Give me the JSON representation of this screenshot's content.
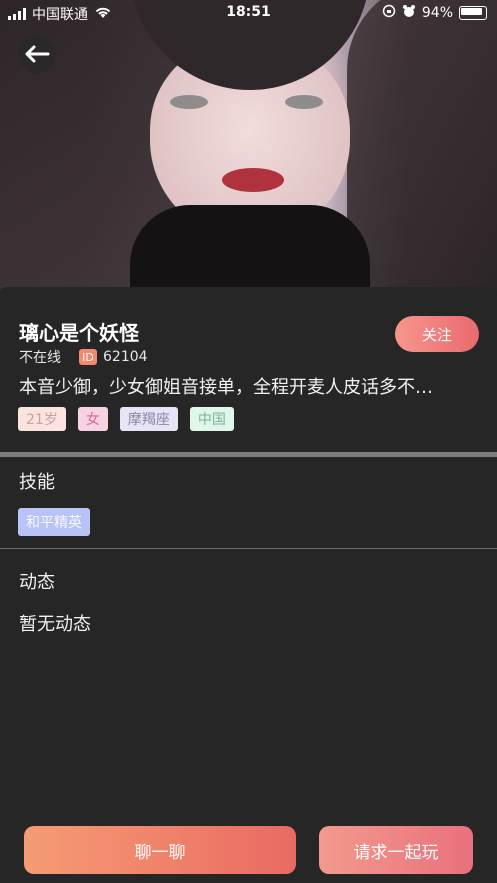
{
  "status_bar": {
    "carrier": "中国联通",
    "time": "18:51",
    "battery": "94%",
    "icons": [
      "signal-icon",
      "wifi-icon",
      "lock-rotation-icon",
      "alarm-icon",
      "battery-icon"
    ]
  },
  "header": {
    "back_icon": "arrow-left-icon"
  },
  "profile": {
    "name": "璃心是个妖怪",
    "follow_label": "关注",
    "status": "不在线",
    "id_badge": "ID",
    "id_number": "62104",
    "bio": "本音少御，少女御姐音接单，全程开麦人皮话多不…",
    "tags": {
      "age": "21岁",
      "gender": "女",
      "zodiac": "摩羯座",
      "country": "中国"
    }
  },
  "skills": {
    "title": "技能",
    "items": [
      "和平精英"
    ]
  },
  "moments": {
    "title": "动态",
    "empty_text": "暂无动态"
  },
  "actions": {
    "chat_label": "聊一聊",
    "play_label": "请求一起玩"
  },
  "colors": {
    "background": "#262626",
    "accent_gradient_start": "#f59c74",
    "accent_gradient_end": "#ea6a62",
    "skill_tag": "#b9c3f7"
  }
}
